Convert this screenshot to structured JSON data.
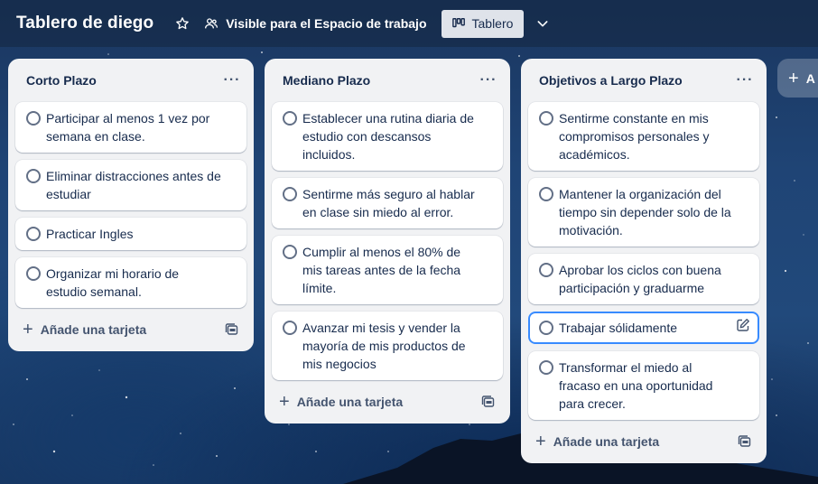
{
  "header": {
    "board_title": "Tablero de diego",
    "visibility_label": "Visible para el Espacio de trabajo",
    "view_label": "Tablero"
  },
  "lists": [
    {
      "title": "Corto Plazo",
      "cards": [
        "Participar al menos 1 vez por semana en clase.",
        "Eliminar distracciones antes de estudiar",
        "Practicar Ingles",
        "Organizar mi horario de estudio semanal."
      ],
      "add_label": "Añade una tarjeta"
    },
    {
      "title": "Mediano Plazo",
      "cards": [
        "Establecer una rutina diaria de estudio con descansos incluidos.",
        "Sentirme más seguro al hablar en clase sin miedo al error.",
        "Cumplir al menos el 80% de mis tareas antes de la fecha límite.",
        "Avanzar mi tesis y vender la mayoría de mis productos de mis negocios"
      ],
      "add_label": "Añade una tarjeta"
    },
    {
      "title": "Objetivos a Largo Plazo",
      "cards": [
        "Sentirme constante en mis compromisos personales y académicos.",
        "Mantener la organización del tiempo sin depender solo de la motivación.",
        "Aprobar los ciclos con buena participación y graduarme",
        "Trabajar sólidamente",
        "Transformar el miedo al fracaso en una oportunidad para crecer."
      ],
      "add_label": "Añade una tarjeta"
    }
  ],
  "add_list_label": "A",
  "colors": {
    "list_bg": "#f1f2f4",
    "card_bg": "#ffffff",
    "text": "#172b4d",
    "focus": "#388bff",
    "view_button_bg": "#dfe3ea"
  },
  "icons": {
    "star": "star-icon",
    "visibility": "people-icon",
    "view": "board-icon",
    "chevron": "chevron-down-icon",
    "more": "more-dots-icon",
    "plus": "plus-icon",
    "template": "template-icon",
    "edit": "pencil-icon"
  }
}
